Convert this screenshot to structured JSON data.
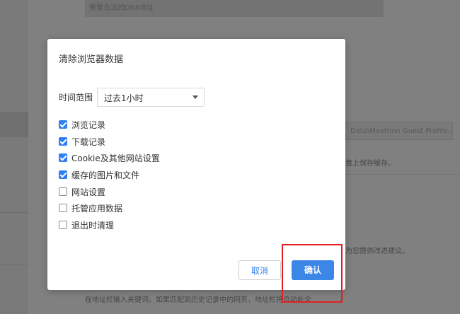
{
  "background": {
    "dns_placeholder": "需要合法的DNS地址",
    "path_field": "Data\\Maxthon Guest Profile...",
    "save_text": "盘上保存缓存。",
    "advice_text": "为您提供改进建议。",
    "bottom_text": "在地址栏输入关键词，如果匹配到历史记录中的网页，地址栏将自动补全"
  },
  "dialog": {
    "title": "清除浏览器数据",
    "time_range_label": "时间范围",
    "time_range_value": "过去1小时",
    "options": [
      {
        "label": "浏览记录",
        "checked": true
      },
      {
        "label": "下载记录",
        "checked": true
      },
      {
        "label": "Cookie及其他网站设置",
        "checked": true
      },
      {
        "label": "缓存的图片和文件",
        "checked": true
      },
      {
        "label": "网站设置",
        "checked": false
      },
      {
        "label": "托管应用数据",
        "checked": false
      },
      {
        "label": "退出时清理",
        "checked": false
      }
    ],
    "cancel_label": "取消",
    "ok_label": "确认"
  },
  "colors": {
    "accent": "#3c86e8",
    "highlight": "#e02020"
  }
}
